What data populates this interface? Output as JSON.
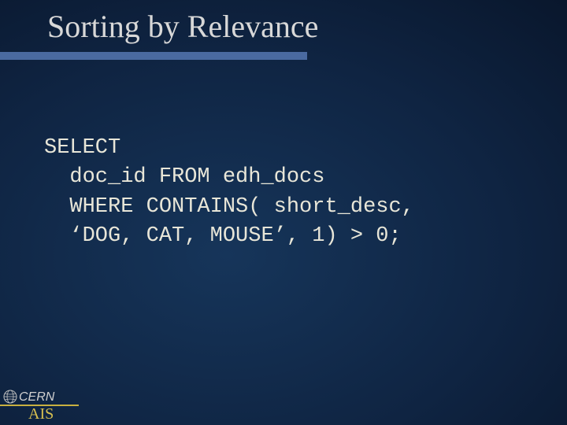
{
  "slide": {
    "title": "Sorting by Relevance",
    "code_line1": "SELECT",
    "code_line2": "  doc_id FROM edh_docs",
    "code_line3": "  WHERE CONTAINS( short_desc,",
    "code_line4": "  ‘DOG, CAT, MOUSE’, 1) > 0;"
  },
  "footer": {
    "org": "CERN",
    "dept": "AIS"
  }
}
